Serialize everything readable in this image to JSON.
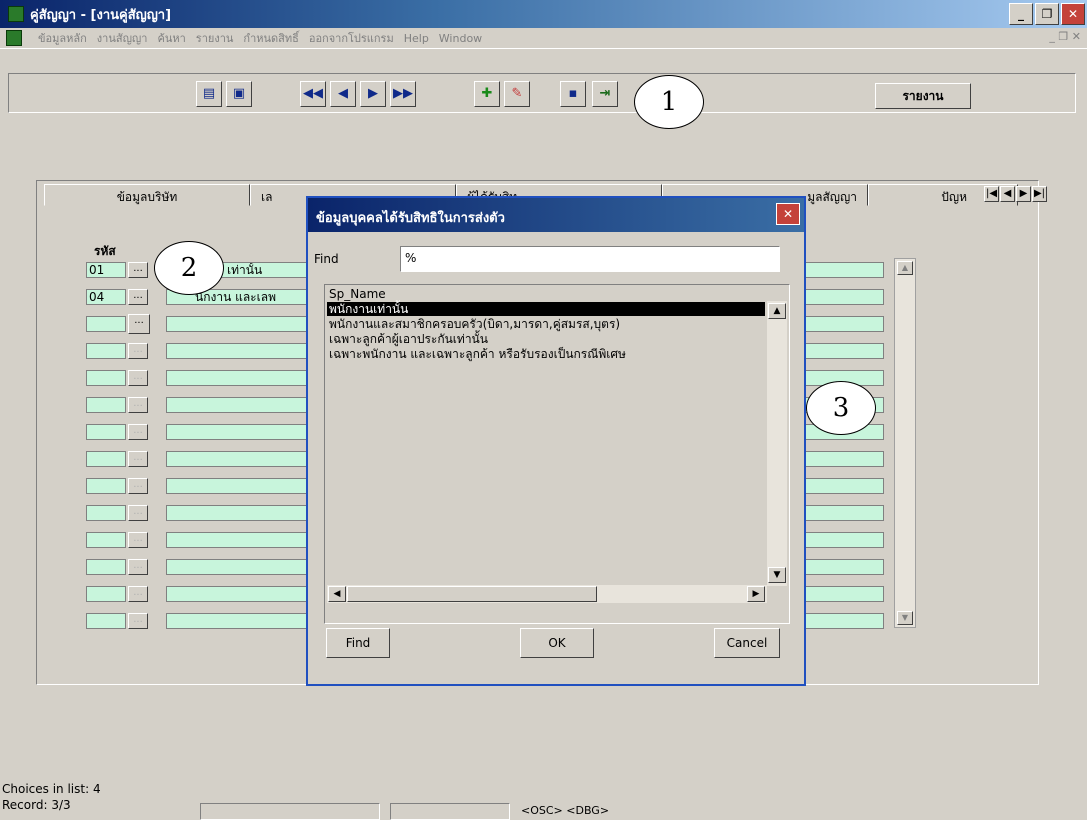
{
  "window": {
    "title": "คู่สัญญา - [งานคู่สัญญา]"
  },
  "menu": {
    "items": [
      "ข้อมูลหลัก",
      "งานสัญญา",
      "ค้นหา",
      "รายงาน",
      "กำหนดสิทธิ์",
      "ออกจากโปรแกรม",
      "Help",
      "Window"
    ]
  },
  "toolbar": {
    "report_label": "รายงาน"
  },
  "callouts": {
    "c1": "1",
    "c2": "2",
    "c3": "3"
  },
  "tabs": [
    {
      "label": "ข้อมูลบริษัท"
    },
    {
      "label": "เล"
    },
    {
      "label": "ผู้ได้รับสิท"
    },
    {
      "label": "มูลสัญญา"
    },
    {
      "label": "ปัญห"
    }
  ],
  "grid": {
    "code_header": "รหัส",
    "rows": [
      {
        "code": "01",
        "btn": "...",
        "name": "เท่านั้น"
      },
      {
        "code": "04",
        "btn": "...",
        "name": "นักงาน และเลพ"
      },
      {
        "code": "",
        "btn": "...",
        "name": ""
      }
    ]
  },
  "dialog": {
    "title": "ข้อมูลบุคคลได้รับสิทธิในการส่งตัว",
    "find_label": "Find",
    "find_value": "%",
    "list_header": "Sp_Name",
    "items": [
      "พนักงานเท่านั้น",
      "พนักงานและสมาชิกครอบครัว(บิดา,มารดา,คู่สมรส,บุตร)",
      "เฉพาะลูกค้าผู้เอาประกันเท่านั้น",
      "เฉพาะพนักงาน และเฉพาะลูกค้า หรือรับรองเป็นกรณีพิเศษ"
    ],
    "find_button": "Find",
    "ok_button": "OK",
    "cancel_button": "Cancel"
  },
  "status": {
    "choices": "Choices in list: 4",
    "record": "Record: 3/3",
    "osc": "<OSC>",
    "dbg": "<DBG>"
  }
}
